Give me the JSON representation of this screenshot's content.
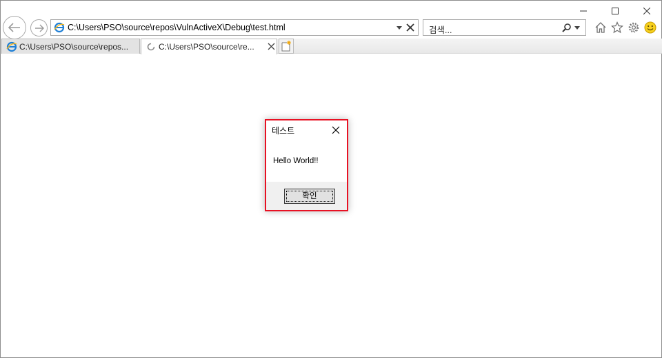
{
  "browser": {
    "address_url": "C:\\Users\\PSO\\source\\repos\\VulnActiveX\\Debug\\test.html",
    "search_placeholder": "검색..."
  },
  "tabs": [
    {
      "label": "C:\\Users\\PSO\\source\\repos...",
      "active": false,
      "icon": "ie-icon"
    },
    {
      "label": "C:\\Users\\PSO\\source\\re...",
      "active": true,
      "icon": "loading-icon"
    }
  ],
  "toolbar_icons": [
    "home-icon",
    "star-icon",
    "gear-icon",
    "smiley-icon"
  ],
  "dialog": {
    "title": "테스트",
    "message": "Hello World!!",
    "ok_label": "확인",
    "border_color": "#e81123"
  }
}
